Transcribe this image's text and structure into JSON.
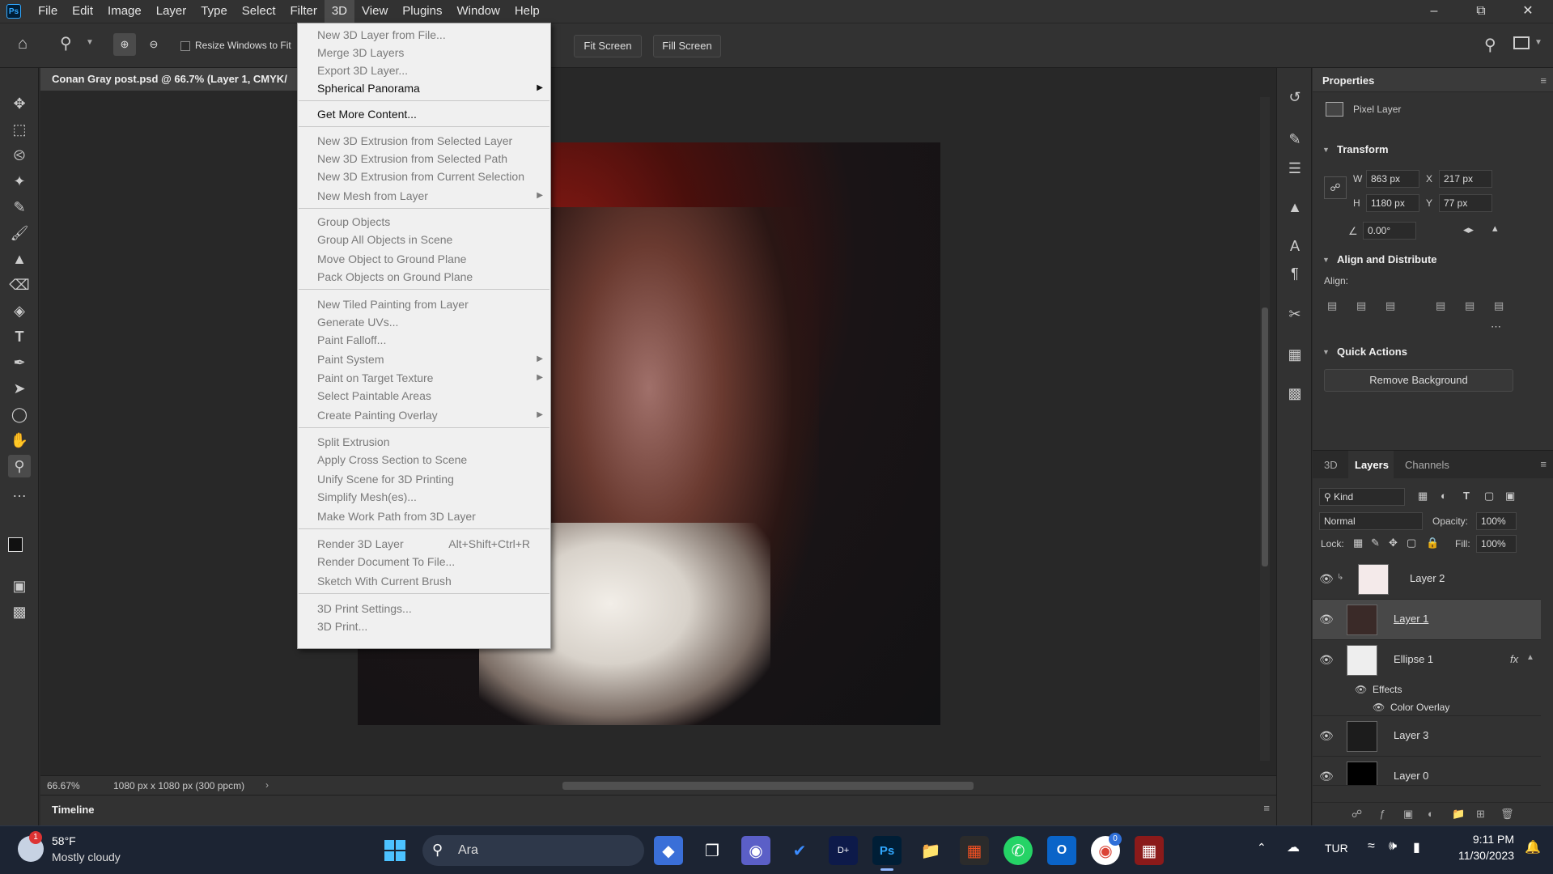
{
  "menubar": {
    "items": [
      "File",
      "Edit",
      "Image",
      "Layer",
      "Type",
      "Select",
      "Filter",
      "3D",
      "View",
      "Plugins",
      "Window",
      "Help"
    ],
    "active": "3D"
  },
  "options": {
    "resize_label": "Resize Windows to Fit",
    "fit_screen": "Fit Screen",
    "fill_screen": "Fill Screen"
  },
  "document": {
    "tab_title": "Conan Gray post.psd @ 66.7% (Layer 1, CMYK/",
    "zoom": "66.67%",
    "size_info": "1080 px x 1080 px (300 ppcm)",
    "timeline": "Timeline"
  },
  "menu3d": {
    "items": [
      {
        "label": "New 3D Layer from File...",
        "enabled": false
      },
      {
        "label": "Merge 3D Layers",
        "enabled": false
      },
      {
        "label": "Export 3D Layer...",
        "enabled": false
      },
      {
        "label": "Spherical Panorama",
        "enabled": true,
        "submenu": true
      },
      {
        "label": "Get More Content...",
        "enabled": true
      },
      {
        "label": "New 3D Extrusion from Selected Layer",
        "enabled": false
      },
      {
        "label": "New 3D Extrusion from Selected Path",
        "enabled": false
      },
      {
        "label": "New 3D Extrusion from Current Selection",
        "enabled": false
      },
      {
        "label": "New Mesh from Layer",
        "enabled": false,
        "submenu": true
      },
      {
        "label": "Group Objects",
        "enabled": false
      },
      {
        "label": "Group All Objects in Scene",
        "enabled": false
      },
      {
        "label": "Move Object to Ground Plane",
        "enabled": false
      },
      {
        "label": "Pack Objects on Ground Plane",
        "enabled": false
      },
      {
        "label": "New Tiled Painting from Layer",
        "enabled": false
      },
      {
        "label": "Generate UVs...",
        "enabled": false
      },
      {
        "label": "Paint Falloff...",
        "enabled": false
      },
      {
        "label": "Paint System",
        "enabled": false,
        "submenu": true
      },
      {
        "label": "Paint on Target Texture",
        "enabled": false,
        "submenu": true
      },
      {
        "label": "Select Paintable Areas",
        "enabled": false
      },
      {
        "label": "Create Painting Overlay",
        "enabled": false,
        "submenu": true
      },
      {
        "label": "Split Extrusion",
        "enabled": false
      },
      {
        "label": "Apply Cross Section to Scene",
        "enabled": false
      },
      {
        "label": "Unify Scene for 3D Printing",
        "enabled": false
      },
      {
        "label": "Simplify Mesh(es)...",
        "enabled": false
      },
      {
        "label": "Make Work Path from 3D Layer",
        "enabled": false
      },
      {
        "label": "Render 3D Layer",
        "enabled": false,
        "shortcut": "Alt+Shift+Ctrl+R"
      },
      {
        "label": "Render Document To File...",
        "enabled": false
      },
      {
        "label": "Sketch With Current Brush",
        "enabled": false
      },
      {
        "label": "3D Print Settings...",
        "enabled": false
      },
      {
        "label": "3D Print...",
        "enabled": false
      }
    ]
  },
  "properties": {
    "title": "Properties",
    "kind": "Pixel Layer",
    "transform_title": "Transform",
    "w_label": "W",
    "w": "863 px",
    "h_label": "H",
    "h": "1180 px",
    "x_label": "X",
    "x": "217 px",
    "y_label": "Y",
    "y": "77 px",
    "angle": "0.00°",
    "align_title": "Align and Distribute",
    "align_label": "Align:",
    "quick_title": "Quick Actions",
    "remove_bg": "Remove Background"
  },
  "layers": {
    "tabs": [
      "3D",
      "Layers",
      "Channels"
    ],
    "active_tab": "Layers",
    "kind": "Kind",
    "blend": "Normal",
    "opacity_label": "Opacity:",
    "opacity": "100%",
    "lock_label": "Lock:",
    "fill_label": "Fill:",
    "fill": "100%",
    "rows": [
      {
        "name": "Layer 2"
      },
      {
        "name": "Layer 1"
      },
      {
        "name": "Ellipse 1",
        "fx": "fx"
      },
      {
        "name": "Layer 3"
      },
      {
        "name": "Layer 0"
      }
    ],
    "effects": "Effects",
    "color_overlay": "Color Overlay"
  },
  "taskbar": {
    "temp": "58°F",
    "weather": "Mostly cloudy",
    "weather_badge": "1",
    "search": "Ara",
    "chrome_badge": "0",
    "lang": "TUR",
    "time": "9:11 PM",
    "date": "11/30/2023"
  },
  "colors": {
    "accent": "#31a8ff",
    "menu_bg": "#f0f0f0",
    "panel": "#323232",
    "taskbar": "#1c2433"
  }
}
